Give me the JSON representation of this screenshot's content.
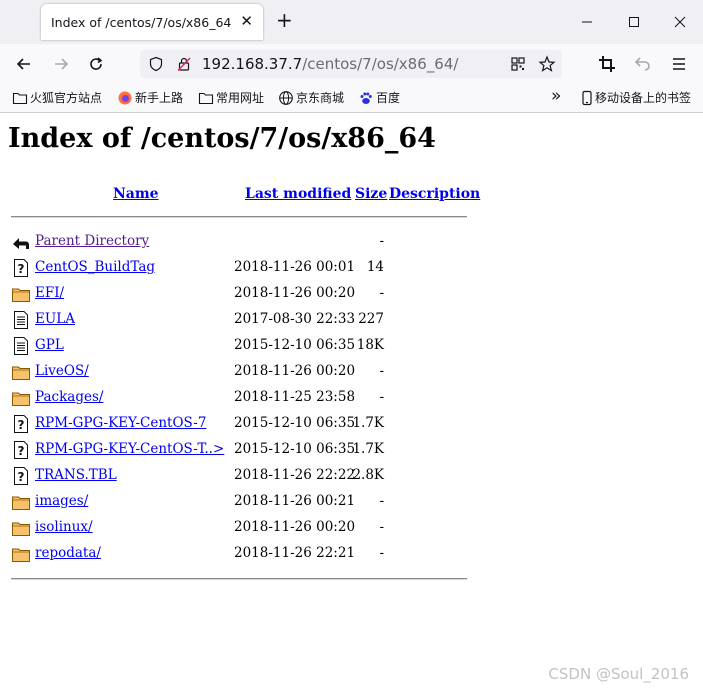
{
  "browser": {
    "tab_title": "Index of /centos/7/os/x86_64",
    "tab_close_glyph": "✕",
    "new_tab_glyph": "+",
    "url_host": "192.168.37.7",
    "url_path": "/centos/7/os/x86_64/"
  },
  "bookmarks": [
    {
      "label": "火狐官方站点",
      "icon": "folder-icon"
    },
    {
      "label": "新手上路",
      "icon": "firefox-icon"
    },
    {
      "label": "常用网址",
      "icon": "folder-icon"
    },
    {
      "label": "京东商城",
      "icon": "globe-icon"
    },
    {
      "label": "百度",
      "icon": "paw-icon"
    },
    {
      "label": "»",
      "icon": "overflow-chevron"
    },
    {
      "label": "移动设备上的书签",
      "icon": "mobile-icon"
    }
  ],
  "page": {
    "title": "Index of /centos/7/os/x86_64",
    "columns": {
      "name": "Name",
      "modified": "Last modified",
      "size": "Size",
      "description": "Description"
    },
    "entries": [
      {
        "name": "Parent Directory",
        "modified": "",
        "size": "-",
        "icon": "back-arrow-icon"
      },
      {
        "name": "CentOS_BuildTag",
        "modified": "2018-11-26 00:01",
        "size": "14",
        "icon": "unknown-file-icon"
      },
      {
        "name": "EFI/",
        "modified": "2018-11-26 00:20",
        "size": "-",
        "icon": "folder-icon"
      },
      {
        "name": "EULA",
        "modified": "2017-08-30 22:33",
        "size": "227",
        "icon": "text-file-icon"
      },
      {
        "name": "GPL",
        "modified": "2015-12-10 06:35",
        "size": "18K",
        "icon": "text-file-icon"
      },
      {
        "name": "LiveOS/",
        "modified": "2018-11-26 00:20",
        "size": "-",
        "icon": "folder-icon"
      },
      {
        "name": "Packages/",
        "modified": "2018-11-25 23:58",
        "size": "-",
        "icon": "folder-icon"
      },
      {
        "name": "RPM-GPG-KEY-CentOS-7",
        "modified": "2015-12-10 06:35",
        "size": "1.7K",
        "icon": "unknown-file-icon"
      },
      {
        "name": "RPM-GPG-KEY-CentOS-T..>",
        "modified": "2015-12-10 06:35",
        "size": "1.7K",
        "icon": "unknown-file-icon"
      },
      {
        "name": "TRANS.TBL",
        "modified": "2018-11-26 22:22",
        "size": "2.8K",
        "icon": "unknown-file-icon"
      },
      {
        "name": "images/",
        "modified": "2018-11-26 00:21",
        "size": "-",
        "icon": "folder-icon"
      },
      {
        "name": "isolinux/",
        "modified": "2018-11-26 00:20",
        "size": "-",
        "icon": "folder-icon"
      },
      {
        "name": "repodata/",
        "modified": "2018-11-26 22:21",
        "size": "-",
        "icon": "folder-icon"
      }
    ]
  },
  "watermark": "CSDN @Soul_2016",
  "colors": {
    "link": "#0000ee",
    "visited_link": "#551a8b",
    "folder_fill": "#f5c26b",
    "folder_stroke": "#8a5a00"
  }
}
